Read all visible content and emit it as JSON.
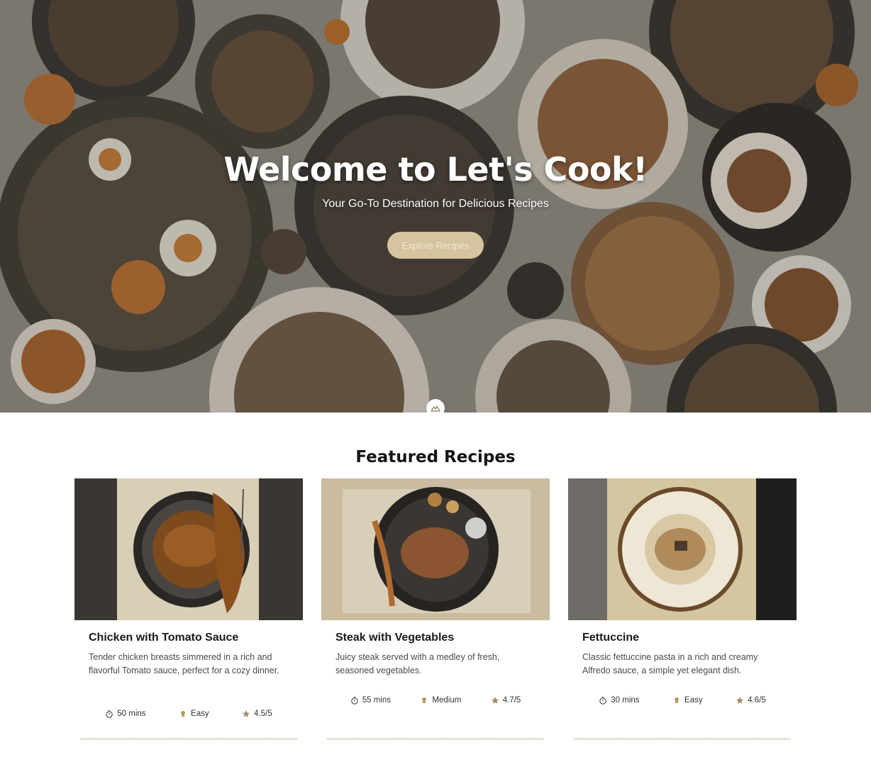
{
  "hero": {
    "title": "Welcome to Let's Cook!",
    "subtitle": "Your Go-To Destination for Delicious Recipes",
    "button_label": "Explore Recipes"
  },
  "featured": {
    "title": "Featured Recipes",
    "recipes": [
      {
        "title": "Chicken with Tomato Sauce",
        "description": "Tender chicken breasts simmered in a rich and flavorful Tomato sauce, perfect for a cozy dinner.",
        "time": "50 mins",
        "difficulty": "Easy",
        "rating": "4.5/5"
      },
      {
        "title": "Steak with Vegetables",
        "description": "Juicy steak served with a medley of fresh, seasoned vegetables.",
        "time": "55 mins",
        "difficulty": "Medium",
        "rating": "4.7/5"
      },
      {
        "title": "Fettuccine",
        "description": "Classic fettuccine pasta in a rich and creamy Alfredo sauce, a simple yet elegant dish.",
        "time": "30 mins",
        "difficulty": "Easy",
        "rating": "4.6/5"
      }
    ]
  },
  "colors": {
    "accent_button": "#d6c4a0",
    "text_dark": "#1a1a1a"
  },
  "icons": {
    "time": "stopwatch-icon",
    "difficulty": "chef-icon",
    "rating": "star-icon",
    "scroll": "mountain-icon"
  }
}
